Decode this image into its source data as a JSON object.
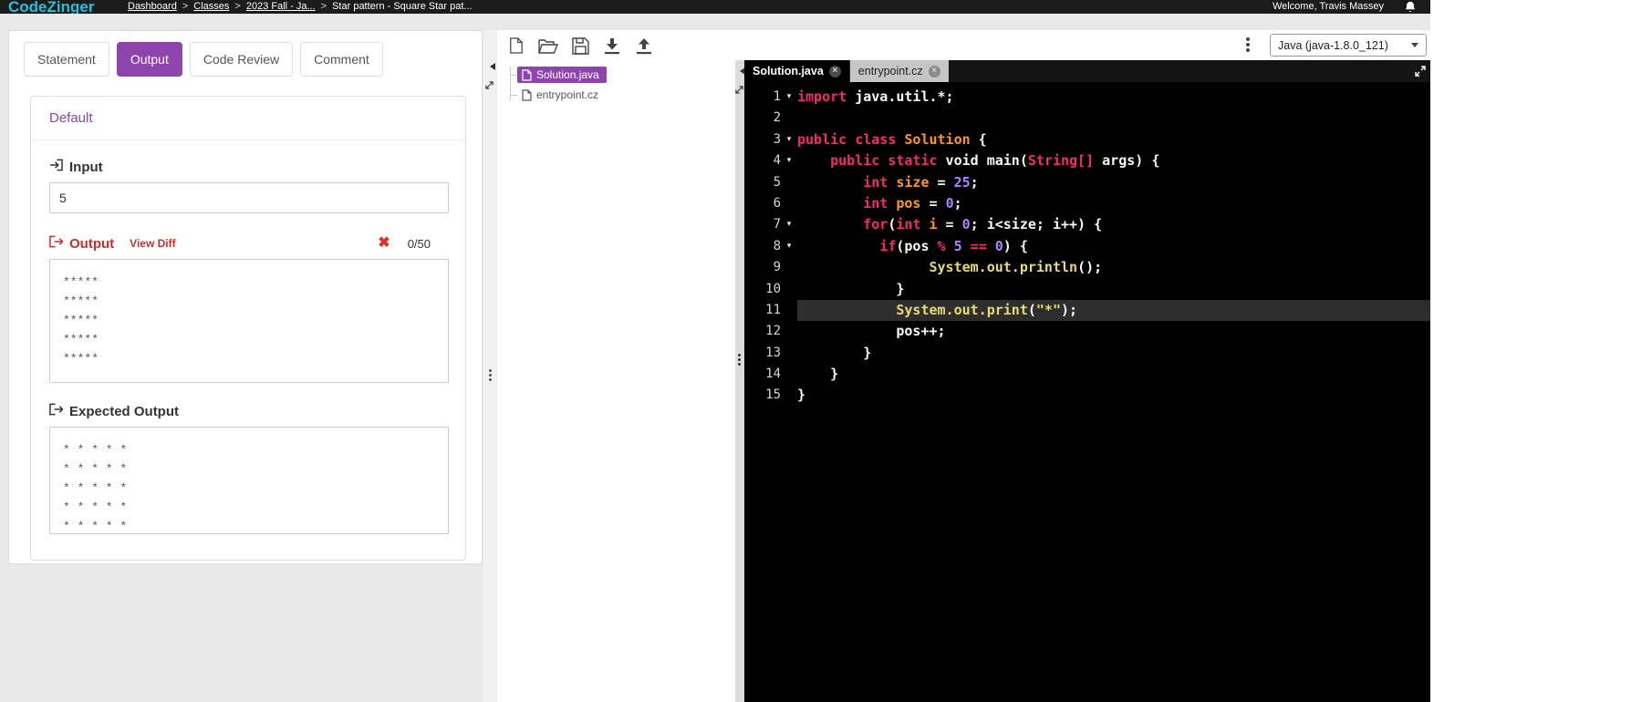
{
  "topbar": {
    "logo": "CodeZinger",
    "breadcrumb": [
      {
        "label": "Dashboard",
        "link": true
      },
      {
        "label": "Classes",
        "link": true
      },
      {
        "label": "2023 Fall - Ja...",
        "link": true
      },
      {
        "label": "Star pattern - Square Star pat...",
        "link": false
      }
    ],
    "welcome": "Welcome, Travis Massey"
  },
  "left_panel": {
    "tabs": [
      {
        "label": "Statement",
        "active": false
      },
      {
        "label": "Output",
        "active": true
      },
      {
        "label": "Code Review",
        "active": false
      },
      {
        "label": "Comment",
        "active": false
      }
    ],
    "card": {
      "title": "Default",
      "input": {
        "label": "Input",
        "value": "5"
      },
      "output": {
        "label": "Output",
        "view_diff_label": "View Diff",
        "score": "0/50",
        "lines": [
          "*****",
          "*****",
          "*****",
          "*****",
          "*****"
        ]
      },
      "expected": {
        "label": "Expected Output",
        "lines": [
          "* * * * *",
          "* * * * *",
          "* * * * *",
          "* * * * *",
          "* * * * *"
        ]
      }
    }
  },
  "file_toolbar": {
    "language_selector": "Java (java-1.8.0_121)"
  },
  "file_tree": {
    "items": [
      {
        "label": "Solution.java",
        "selected": true
      },
      {
        "label": "entrypoint.cz",
        "selected": false
      }
    ]
  },
  "editor": {
    "tabs": [
      {
        "label": "Solution.java",
        "active": true
      },
      {
        "label": "entrypoint.cz",
        "active": false
      }
    ],
    "lines": [
      {
        "n": 1,
        "fold": true,
        "tokens": [
          [
            "kw",
            "import"
          ],
          [
            "pl",
            " java.util.*;"
          ]
        ]
      },
      {
        "n": 2,
        "tokens": []
      },
      {
        "n": 3,
        "fold": true,
        "tokens": [
          [
            "kw",
            "public class"
          ],
          [
            "pl",
            " "
          ],
          [
            "cls",
            "Solution"
          ],
          [
            "pl",
            " {"
          ]
        ]
      },
      {
        "n": 4,
        "fold": true,
        "tokens": [
          [
            "pl",
            "    "
          ],
          [
            "kw",
            "public static"
          ],
          [
            "pl",
            " void main("
          ],
          [
            "kw",
            "String[]"
          ],
          [
            "pl",
            " args) {"
          ]
        ]
      },
      {
        "n": 5,
        "tokens": [
          [
            "pl",
            "        "
          ],
          [
            "kw",
            "int"
          ],
          [
            "pl",
            " "
          ],
          [
            "def",
            "size"
          ],
          [
            "pl",
            " = "
          ],
          [
            "num",
            "25"
          ],
          [
            "pl",
            ";"
          ]
        ]
      },
      {
        "n": 6,
        "tokens": [
          [
            "pl",
            "        "
          ],
          [
            "kw",
            "int"
          ],
          [
            "pl",
            " "
          ],
          [
            "def",
            "pos"
          ],
          [
            "pl",
            " = "
          ],
          [
            "num",
            "0"
          ],
          [
            "pl",
            ";"
          ]
        ]
      },
      {
        "n": 7,
        "fold": true,
        "tokens": [
          [
            "pl",
            "        "
          ],
          [
            "kw",
            "for"
          ],
          [
            "pl",
            "("
          ],
          [
            "kw",
            "int"
          ],
          [
            "pl",
            " "
          ],
          [
            "def",
            "i"
          ],
          [
            "pl",
            " = "
          ],
          [
            "num",
            "0"
          ],
          [
            "pl",
            "; i<size; i++) {"
          ]
        ]
      },
      {
        "n": 8,
        "fold": true,
        "tokens": [
          [
            "pl",
            "          "
          ],
          [
            "kw",
            "if"
          ],
          [
            "pl",
            "(pos "
          ],
          [
            "op",
            "%"
          ],
          [
            "pl",
            " "
          ],
          [
            "num",
            "5"
          ],
          [
            "pl",
            " "
          ],
          [
            "op",
            "=="
          ],
          [
            "pl",
            " "
          ],
          [
            "num",
            "0"
          ],
          [
            "pl",
            ") {"
          ]
        ]
      },
      {
        "n": 9,
        "tokens": [
          [
            "pl",
            "                "
          ],
          [
            "fn",
            "System.out.println"
          ],
          [
            "pl",
            "();"
          ]
        ]
      },
      {
        "n": 10,
        "tokens": [
          [
            "pl",
            "            }"
          ]
        ]
      },
      {
        "n": 11,
        "highlight": true,
        "tokens": [
          [
            "pl",
            "            "
          ],
          [
            "fn",
            "System.out.print"
          ],
          [
            "pl",
            "("
          ],
          [
            "str",
            "\"*\""
          ],
          [
            "pl",
            ");"
          ]
        ]
      },
      {
        "n": 12,
        "tokens": [
          [
            "pl",
            "            pos++;"
          ]
        ]
      },
      {
        "n": 13,
        "tokens": [
          [
            "pl",
            "        }"
          ]
        ]
      },
      {
        "n": 14,
        "tokens": [
          [
            "pl",
            "    }"
          ]
        ]
      },
      {
        "n": 15,
        "tokens": [
          [
            "pl",
            "}"
          ]
        ]
      }
    ]
  },
  "colors": {
    "accent_purple": "#8e44ad",
    "logo_cyan": "#2ac0d6",
    "error_red": "#c9302c",
    "editor_bg": "#000000",
    "keyword": "#f92672",
    "classname": "#fd971f",
    "number": "#ae81ff",
    "function_call": "#e6db74",
    "string": "#e6db74",
    "plain_code": "#f8f8f2"
  }
}
